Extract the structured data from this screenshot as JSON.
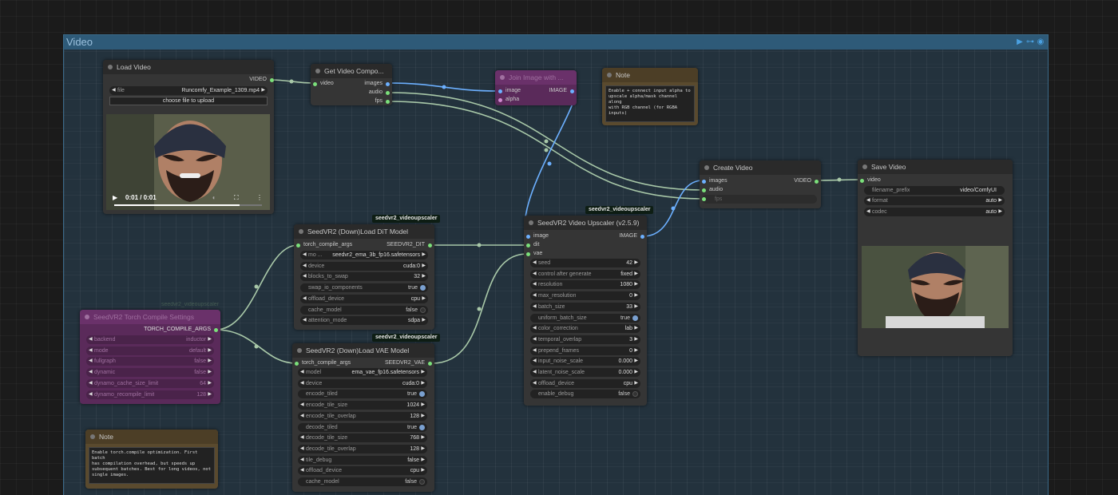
{
  "group": {
    "title": "Video",
    "icons": [
      "play-icon",
      "pipeline-icon",
      "eye-icon"
    ]
  },
  "colors": {
    "canvas": "#1b1b1b",
    "group": "#2e5a78",
    "node": "#353535",
    "wire": "#a8c8a8",
    "image_wire": "#6cb0ff",
    "purple_node": "#5a2a5a",
    "note_node": "#5a4a2e"
  },
  "load_video": {
    "title": "Load Video",
    "output": "VIDEO",
    "file_label": "file",
    "file_value": "Runcomfy_Example_1309.mp4",
    "upload_button": "choose file to upload",
    "time": "0:01 / 0:01",
    "playback_progress": 0.85
  },
  "get_video_components": {
    "title": "Get Video Compo...",
    "input": "video",
    "outputs": [
      "images",
      "audio",
      "fps"
    ]
  },
  "join_image": {
    "title": "Join Image with ...",
    "inputs": [
      "image",
      "alpha"
    ],
    "output": "IMAGE"
  },
  "note_top": {
    "title": "Note",
    "text": "Enable + connect input alpha to\nupscale alpha/mask channel along\nwith RGB channel (for RGBA\ninputs)"
  },
  "create_video": {
    "title": "Create Video",
    "inputs": [
      "images",
      "audio",
      "fps"
    ],
    "output": "VIDEO"
  },
  "save_video": {
    "title": "Save Video",
    "input": "video",
    "widgets": [
      {
        "label": "filename_prefix",
        "value": "video/ComfyUI"
      },
      {
        "label": "format",
        "value": "auto"
      },
      {
        "label": "codec",
        "value": "auto"
      }
    ]
  },
  "dit_model": {
    "badge": "seedvr2_videoupscaler",
    "title": "SeedVR2 (Down)Load DiT Model",
    "input": "torch_compile_args",
    "output": "SEEDVR2_DIT",
    "widgets": [
      {
        "label": "mo ...",
        "value": "seedvr2_ema_3b_fp16.safetensors",
        "kind": "combo"
      },
      {
        "label": "device",
        "value": "cuda:0",
        "kind": "combo"
      },
      {
        "label": "blocks_to_swap",
        "value": "32",
        "kind": "combo"
      },
      {
        "label": "swap_io_components",
        "value": "true",
        "kind": "bool_on"
      },
      {
        "label": "offload_device",
        "value": "cpu",
        "kind": "combo"
      },
      {
        "label": "cache_model",
        "value": "false",
        "kind": "bool_off"
      },
      {
        "label": "attention_mode",
        "value": "sdpa",
        "kind": "combo"
      }
    ]
  },
  "vae_model": {
    "badge": "seedvr2_videoupscaler",
    "title": "SeedVR2 (Down)Load VAE Model",
    "input": "torch_compile_args",
    "output": "SEEDVR2_VAE",
    "widgets": [
      {
        "label": "model",
        "value": "ema_vae_fp16.safetensors",
        "kind": "combo"
      },
      {
        "label": "device",
        "value": "cuda:0",
        "kind": "combo"
      },
      {
        "label": "encode_tiled",
        "value": "true",
        "kind": "bool_on"
      },
      {
        "label": "encode_tile_size",
        "value": "1024",
        "kind": "combo"
      },
      {
        "label": "encode_tile_overlap",
        "value": "128",
        "kind": "combo"
      },
      {
        "label": "decode_tiled",
        "value": "true",
        "kind": "bool_on"
      },
      {
        "label": "decode_tile_size",
        "value": "768",
        "kind": "combo"
      },
      {
        "label": "decode_tile_overlap",
        "value": "128",
        "kind": "combo"
      },
      {
        "label": "tile_debug",
        "value": "false",
        "kind": "combo"
      },
      {
        "label": "offload_device",
        "value": "cpu",
        "kind": "combo"
      },
      {
        "label": "cache_model",
        "value": "false",
        "kind": "bool_off"
      }
    ]
  },
  "torch_compile": {
    "badge": "seedvr2_videoupscaler",
    "title": "SeedVR2 Torch Compile Settings",
    "output": "TORCH_COMPILE_ARGS",
    "widgets": [
      {
        "label": "backend",
        "value": "inductor"
      },
      {
        "label": "mode",
        "value": "default"
      },
      {
        "label": "fullgraph",
        "value": "false"
      },
      {
        "label": "dynamic",
        "value": "false"
      },
      {
        "label": "dynamo_cache_size_limit",
        "value": "64"
      },
      {
        "label": "dynamo_recompile_limit",
        "value": "128"
      }
    ]
  },
  "upscaler": {
    "badge": "seedvr2_videoupscaler",
    "title": "SeedVR2 Video Upscaler (v2.5.9)",
    "inputs": [
      "image",
      "dit",
      "vae"
    ],
    "output": "IMAGE",
    "widgets": [
      {
        "label": "seed",
        "value": "42",
        "kind": "combo"
      },
      {
        "label": "control after generate",
        "value": "fixed",
        "kind": "combo"
      },
      {
        "label": "resolution",
        "value": "1080",
        "kind": "combo"
      },
      {
        "label": "max_resolution",
        "value": "0",
        "kind": "combo"
      },
      {
        "label": "batch_size",
        "value": "33",
        "kind": "combo"
      },
      {
        "label": "uniform_batch_size",
        "value": "true",
        "kind": "bool_on"
      },
      {
        "label": "color_correction",
        "value": "lab",
        "kind": "combo"
      },
      {
        "label": "temporal_overlap",
        "value": "3",
        "kind": "combo"
      },
      {
        "label": "prepend_frames",
        "value": "0",
        "kind": "combo"
      },
      {
        "label": "input_noise_scale",
        "value": "0.000",
        "kind": "combo"
      },
      {
        "label": "latent_noise_scale",
        "value": "0.000",
        "kind": "combo"
      },
      {
        "label": "offload_device",
        "value": "cpu",
        "kind": "combo"
      },
      {
        "label": "enable_debug",
        "value": "false",
        "kind": "bool_off"
      }
    ]
  },
  "note_bottom": {
    "title": "Note",
    "text": "Enable torch.compile optimization. First batch\nhas compilation overhead, but speeds up\nsubsequent batches. Best for long videos, not\nsingle images."
  }
}
